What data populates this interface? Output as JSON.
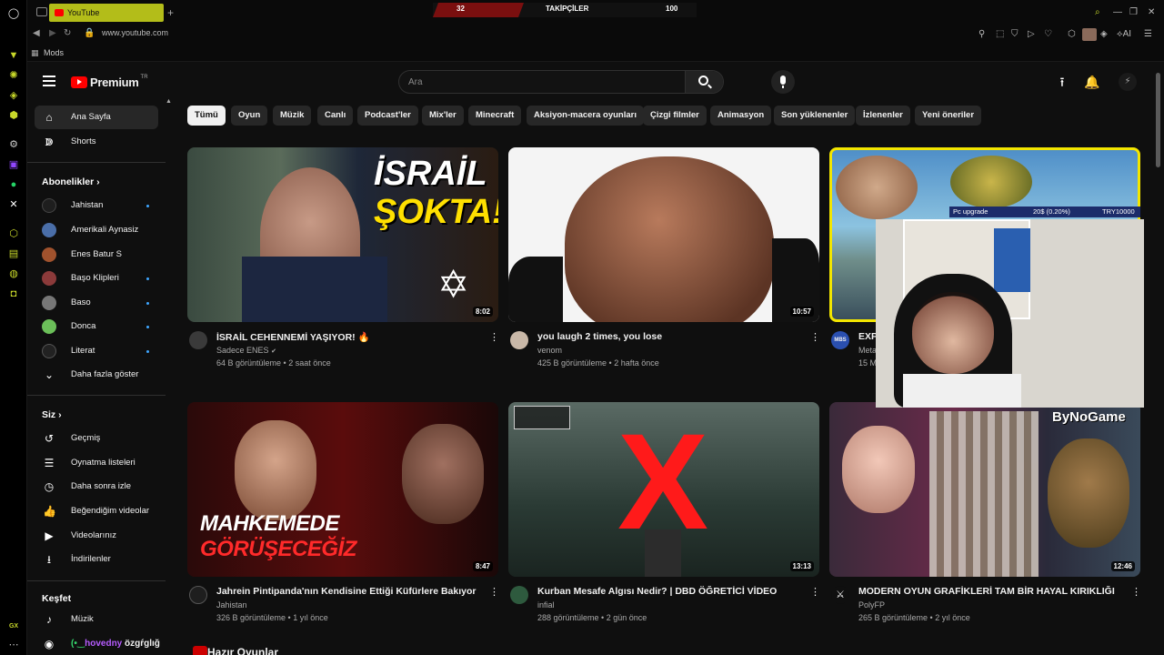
{
  "browser": {
    "tab_title": "YouTube",
    "url": "www.youtube.com",
    "bookmark": "Mods",
    "ai_label": "AI",
    "gx_label": "GX"
  },
  "overlay": {
    "left_count": "32",
    "label": "TAKİPÇİLER",
    "right_count": "100"
  },
  "header": {
    "logo_text": "Premium",
    "country": "TR",
    "search_placeholder": "Ara"
  },
  "sidebar": {
    "main": [
      {
        "label": "Ana Sayfa",
        "icon": "home-icon"
      },
      {
        "label": "Shorts",
        "icon": "shorts-icon"
      }
    ],
    "subs_title": "Abonelikler",
    "subscriptions": [
      {
        "label": "Jahistan",
        "dot": true,
        "color": "#1e1e1e"
      },
      {
        "label": "Amerikali Aynasiz",
        "dot": false,
        "color": "#4a6ea8"
      },
      {
        "label": "Enes Batur S",
        "dot": false,
        "color": "#a0522d"
      },
      {
        "label": "Başo Klipleri",
        "dot": true,
        "color": "#8b3a3a"
      },
      {
        "label": "Baso",
        "dot": true,
        "color": "#777"
      },
      {
        "label": "Donca",
        "dot": true,
        "color": "#6bbf59"
      },
      {
        "label": "Literat",
        "dot": true,
        "color": "#222"
      }
    ],
    "show_more": "Daha fazla göster",
    "you_title": "Siz",
    "you_items": [
      {
        "label": "Geçmiş",
        "icon": "history-icon"
      },
      {
        "label": "Oynatma listeleri",
        "icon": "playlist-icon"
      },
      {
        "label": "Daha sonra izle",
        "icon": "clock-icon"
      },
      {
        "label": "Beğendiğim videolar",
        "icon": "thumbs-up-icon"
      },
      {
        "label": "Videolarınız",
        "icon": "video-icon"
      },
      {
        "label": "İndirilenler",
        "icon": "download-icon"
      }
    ],
    "explore_title": "Keşfet",
    "explore_items": [
      {
        "label": "Müzik",
        "icon": "music-icon"
      }
    ]
  },
  "chips": [
    "Tümü",
    "Oyun",
    "Müzik",
    "Canlı",
    "Podcast'ler",
    "Mix'ler",
    "Minecraft",
    "Aksiyon-macera oyunları",
    "Çizgi filmler",
    "Animasyon",
    "Son yüklenenler",
    "İzlenenler",
    "Yeni öneriler"
  ],
  "videos": [
    {
      "title": "İSRAİL CEHENNEMİ YAŞIYOR! 🔥",
      "channel": "Sadece ENES",
      "verified": "✔",
      "meta": "64 B görüntüleme • 2 saat önce",
      "duration": "8:02",
      "thumb_text": "İSRAİL ŞOKTA!"
    },
    {
      "title": "you laugh 2 times, you lose",
      "channel": "venom",
      "meta": "425 B görüntüleme • 2 hafta önce",
      "duration": "10:57"
    },
    {
      "title": "EXP",
      "channel": "Meta",
      "meta": "15 M",
      "duration": "",
      "avatar_text": "MBS"
    },
    {
      "title": "Jahrein Pintipanda'nın Kendisine Ettiği Küfürlere Bakıyor",
      "channel": "Jahistan",
      "meta": "326 B görüntüleme • 1 yıl önce",
      "duration": "8:47",
      "thumb_text": "MAHKEMEDE GÖRÜŞECEĞİZ"
    },
    {
      "title": "Kurban Mesafe Algısı Nedir? | DBD ÖĞRETİCİ VİDEO",
      "channel": "infial",
      "meta": "288 görüntüleme • 2 gün önce",
      "duration": "13:13",
      "thumb_text": "X"
    },
    {
      "title": "MODERN OYUN GRAFİKLERİ TAM BİR HAYAL KIRIKLIĞI",
      "channel": "PolyFP",
      "meta": "265 B görüntüleme • 2 yıl önce",
      "duration": "12:46",
      "thumb_text": "ByNoGame"
    }
  ],
  "pc_upgrade": {
    "label": "Pc upgrade",
    "value": "20$ (0.20%)",
    "goal": "TRY10000"
  },
  "next_section": "Hazır Oyunlar",
  "stream_badge": {
    "part1": "(•‿",
    "part2": "hovedny",
    "part3": "özgŕglığ"
  }
}
